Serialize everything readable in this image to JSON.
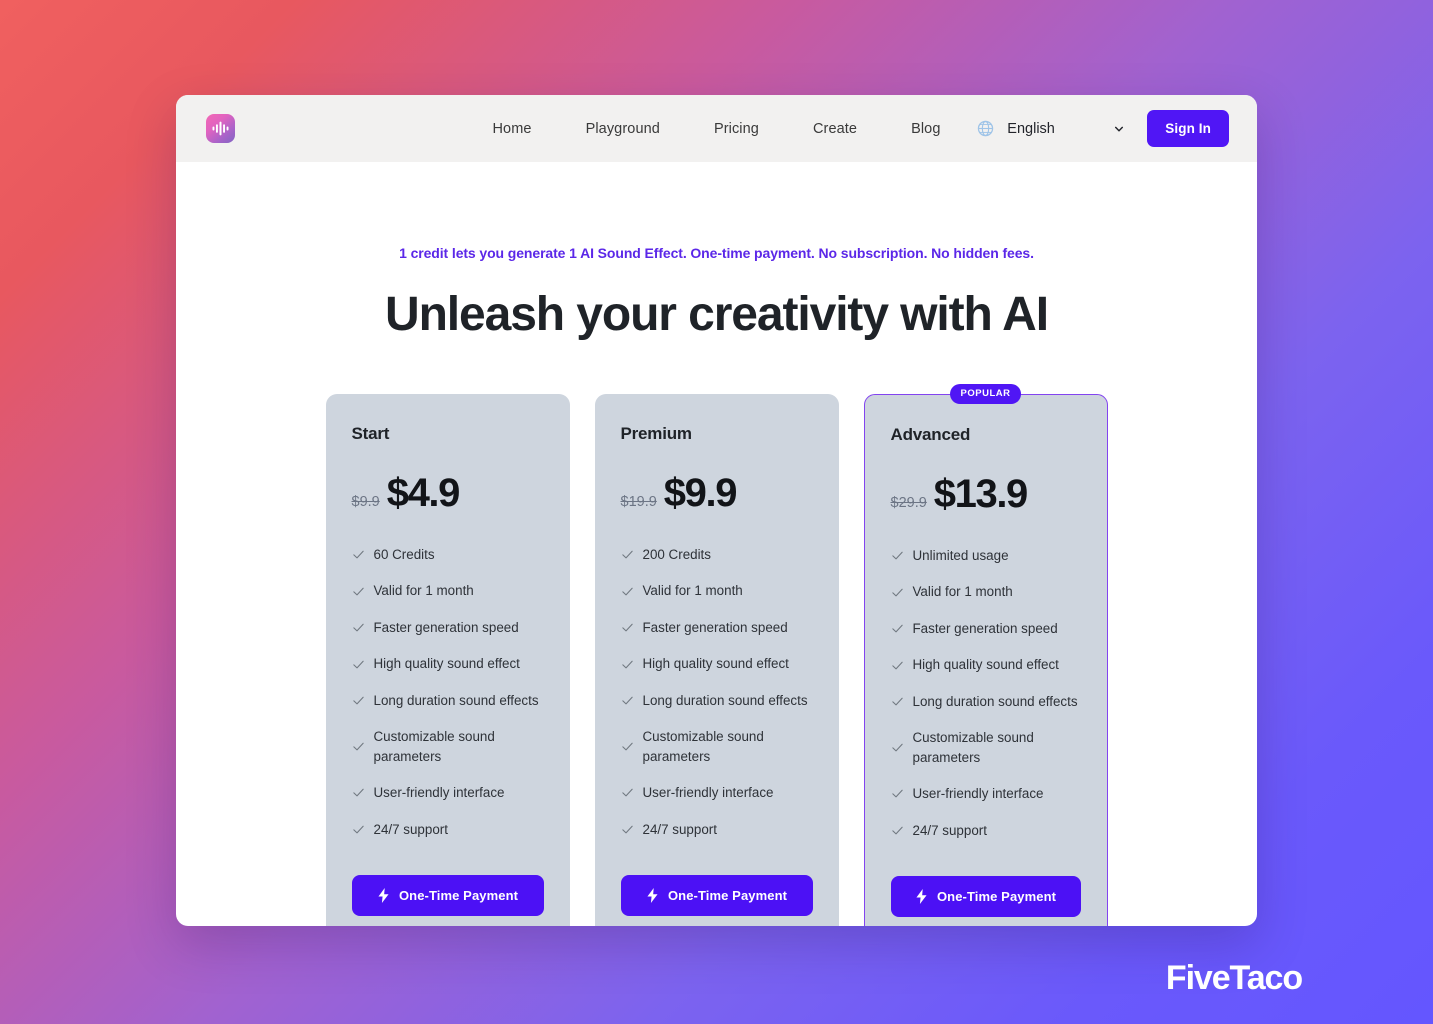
{
  "header": {
    "logo_icon": "audio-waveform-icon",
    "nav": [
      {
        "label": "Home"
      },
      {
        "label": "Playground"
      },
      {
        "label": "Pricing"
      },
      {
        "label": "Create"
      },
      {
        "label": "Blog"
      }
    ],
    "language": {
      "icon": "globe-icon",
      "selected": "English",
      "options": [
        "English"
      ],
      "chevron_icon": "chevron-down-icon"
    },
    "sign_in_label": "Sign In"
  },
  "hero": {
    "tagline": "1 credit lets you generate 1 AI Sound Effect. One-time payment. No subscription. No hidden fees.",
    "title": "Unleash your creativity with AI"
  },
  "pricing": {
    "badge_label": "POPULAR",
    "cta_label": "One-Time Payment",
    "cta_icon": "lightning-bolt-icon",
    "check_icon": "check-icon",
    "plans": [
      {
        "name": "Start",
        "price_old": "$9.9",
        "price_now": "$4.9",
        "featured": false,
        "features": [
          "60 Credits",
          "Valid for 1 month",
          "Faster generation speed",
          "High quality sound effect",
          "Long duration sound effects",
          "Customizable sound parameters",
          "User-friendly interface",
          "24/7 support"
        ]
      },
      {
        "name": "Premium",
        "price_old": "$19.9",
        "price_now": "$9.9",
        "featured": false,
        "features": [
          "200 Credits",
          "Valid for 1 month",
          "Faster generation speed",
          "High quality sound effect",
          "Long duration sound effects",
          "Customizable sound parameters",
          "User-friendly interface",
          "24/7 support"
        ]
      },
      {
        "name": "Advanced",
        "price_old": "$29.9",
        "price_now": "$13.9",
        "featured": true,
        "features": [
          "Unlimited usage",
          "Valid for 1 month",
          "Faster generation speed",
          "High quality sound effect",
          "Long duration sound effects",
          "Customizable sound parameters",
          "User-friendly interface",
          "24/7 support"
        ]
      }
    ]
  },
  "watermark": {
    "text": "FiveTaco"
  },
  "colors": {
    "accent_purple": "#5016f5",
    "cta_purple": "#4c11f5",
    "tagline_purple": "#5b27e8",
    "card_bg": "#ced5de",
    "featured_border": "#8344f0",
    "header_bg": "#f2f1f0",
    "panel_bg": "#ffffff",
    "bg_gradient_start": "#f0605f",
    "bg_gradient_mid": "#a162d0",
    "bg_gradient_end": "#6456ff"
  }
}
